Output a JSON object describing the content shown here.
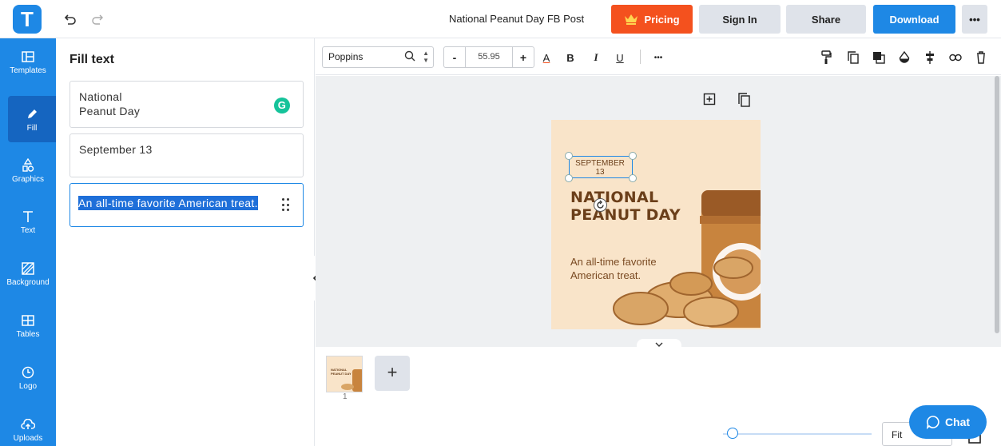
{
  "app": {
    "logo_letter": "T",
    "document_title": "National Peanut Day FB Post",
    "brand_color": "#1e88e5",
    "accent_color": "#f4511e"
  },
  "header": {
    "pricing_label": "Pricing",
    "signin_label": "Sign In",
    "share_label": "Share",
    "download_label": "Download",
    "more_label": "•••"
  },
  "sidebar": {
    "items": [
      {
        "label": "Templates",
        "icon": "templates-icon"
      },
      {
        "label": "Fill",
        "icon": "pencil-icon"
      },
      {
        "label": "Graphics",
        "icon": "shapes-icon"
      },
      {
        "label": "Text",
        "icon": "text-icon"
      },
      {
        "label": "Background",
        "icon": "background-icon"
      },
      {
        "label": "Tables",
        "icon": "table-icon"
      },
      {
        "label": "Logo",
        "icon": "logo-icon"
      },
      {
        "label": "Uploads",
        "icon": "upload-cloud-icon"
      }
    ]
  },
  "panel": {
    "title": "Fill text",
    "fields": [
      {
        "line1": "National",
        "line2": "Peanut Day"
      },
      {
        "value": "September 13"
      },
      {
        "value": "An all-time favorite American treat."
      }
    ],
    "grammarly_letter": "G"
  },
  "toolbar": {
    "font_family": "Poppins",
    "font_size": "55.95",
    "minus": "-",
    "plus": "+",
    "bold": "B",
    "italic": "I",
    "underline": "U",
    "color_letter": "A",
    "more": "•••"
  },
  "design": {
    "date_line1": "SEPTEMBER",
    "date_line2": "13",
    "title_line1": "NATIONAL",
    "title_line2": "PEANUT DAY",
    "subtitle_line1": "An all-time favorite",
    "subtitle_line2": "American treat."
  },
  "pages": {
    "page_number": "1",
    "add_label": "+",
    "thumb_title_1": "NATIONAL",
    "thumb_title_2": "PEANUT DAY"
  },
  "bottom": {
    "zoom_value": "Fit",
    "zoom_fraction": 0.03,
    "chat_label": "Chat"
  }
}
